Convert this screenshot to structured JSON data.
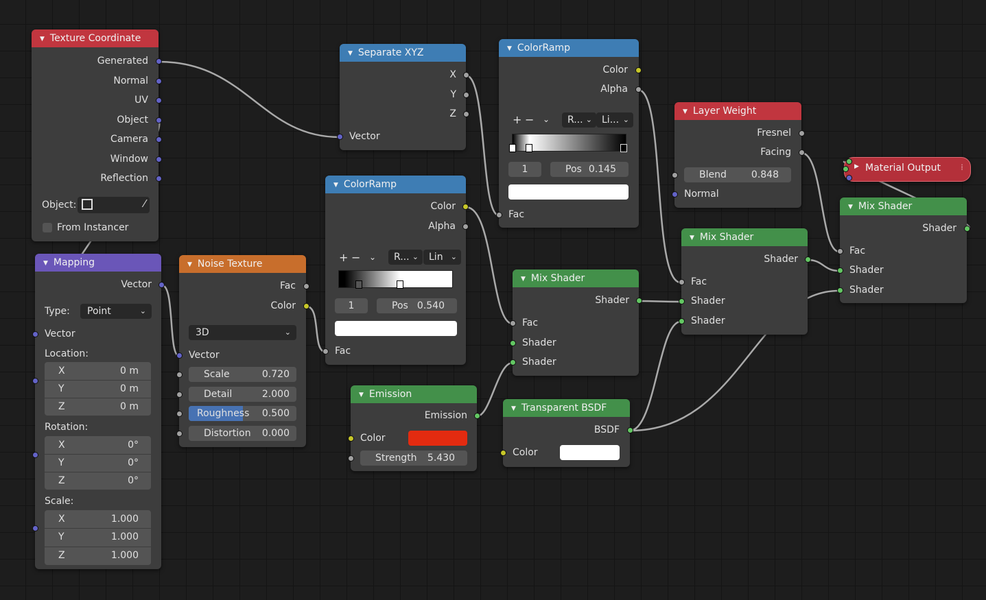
{
  "texture_coordinate": {
    "title": "Texture Coordinate",
    "outputs": [
      "Generated",
      "Normal",
      "UV",
      "Object",
      "Camera",
      "Window",
      "Reflection"
    ],
    "object_label": "Object:",
    "from_instancer": "From Instancer"
  },
  "mapping": {
    "title": "Mapping",
    "out_vector": "Vector",
    "type_label": "Type:",
    "type_value": "Point",
    "in_vector": "Vector",
    "location_label": "Location:",
    "location": [
      {
        "axis": "X",
        "value": "0 m"
      },
      {
        "axis": "Y",
        "value": "0 m"
      },
      {
        "axis": "Z",
        "value": "0 m"
      }
    ],
    "rotation_label": "Rotation:",
    "rotation": [
      {
        "axis": "X",
        "value": "0°"
      },
      {
        "axis": "Y",
        "value": "0°"
      },
      {
        "axis": "Z",
        "value": "0°"
      }
    ],
    "scale_label": "Scale:",
    "scale": [
      {
        "axis": "X",
        "value": "1.000"
      },
      {
        "axis": "Y",
        "value": "1.000"
      },
      {
        "axis": "Z",
        "value": "1.000"
      }
    ]
  },
  "noise_texture": {
    "title": "Noise Texture",
    "out_fac": "Fac",
    "out_color": "Color",
    "dimensions": "3D",
    "in_vector": "Vector",
    "scale": {
      "label": "Scale",
      "value": "0.720"
    },
    "detail": {
      "label": "Detail",
      "value": "2.000"
    },
    "roughness": {
      "label": "Roughness",
      "value": "0.500",
      "fraction": 0.5
    },
    "distortion": {
      "label": "Distortion",
      "value": "0.000"
    }
  },
  "separate_xyz": {
    "title": "Separate XYZ",
    "outputs": [
      "X",
      "Y",
      "Z"
    ],
    "in_vector": "Vector"
  },
  "colorramp_1": {
    "title": "ColorRamp",
    "out_color": "Color",
    "out_alpha": "Alpha",
    "color_mode": "R...",
    "interpolation": "Lin",
    "index": "1",
    "pos_label": "Pos",
    "pos_value": "0.540",
    "in_fac": "Fac",
    "stops": [
      0.145,
      0.54
    ]
  },
  "colorramp_2": {
    "title": "ColorRamp",
    "out_color": "Color",
    "out_alpha": "Alpha",
    "color_mode": "R...",
    "interpolation": "Li...",
    "index": "1",
    "pos_label": "Pos",
    "pos_value": "0.145",
    "in_fac": "Fac",
    "stops": [
      0.0,
      0.145,
      1.0
    ]
  },
  "emission": {
    "title": "Emission",
    "out_emission": "Emission",
    "in_color": "Color",
    "color": "#e32b10",
    "strength": {
      "label": "Strength",
      "value": "5.430"
    }
  },
  "transparent_bsdf": {
    "title": "Transparent BSDF",
    "out_bsdf": "BSDF",
    "in_color": "Color",
    "color": "#ffffff"
  },
  "mix_shader_1": {
    "title": "Mix Shader",
    "out_shader": "Shader",
    "in_fac": "Fac",
    "in_shader_1": "Shader",
    "in_shader_2": "Shader"
  },
  "mix_shader_2": {
    "title": "Mix Shader",
    "out_shader": "Shader",
    "in_fac": "Fac",
    "in_shader_1": "Shader",
    "in_shader_2": "Shader"
  },
  "mix_shader_3": {
    "title": "Mix Shader",
    "out_shader": "Shader",
    "in_fac": "Fac",
    "in_shader_1": "Shader",
    "in_shader_2": "Shader"
  },
  "layer_weight": {
    "title": "Layer Weight",
    "out_fresnel": "Fresnel",
    "out_facing": "Facing",
    "blend": {
      "label": "Blend",
      "value": "0.848"
    },
    "in_normal": "Normal"
  },
  "material_output": {
    "title": "Material Output"
  },
  "colors": {
    "header_red": "#c1363f",
    "header_blue": "#3e7db4",
    "header_green": "#43904a",
    "header_orange": "#c86e2c",
    "header_purple": "#6a56b8",
    "socket_gray": "#a1a1a1",
    "socket_yellow": "#c7c729",
    "socket_purple": "#6363c7",
    "socket_green": "#63c763"
  }
}
